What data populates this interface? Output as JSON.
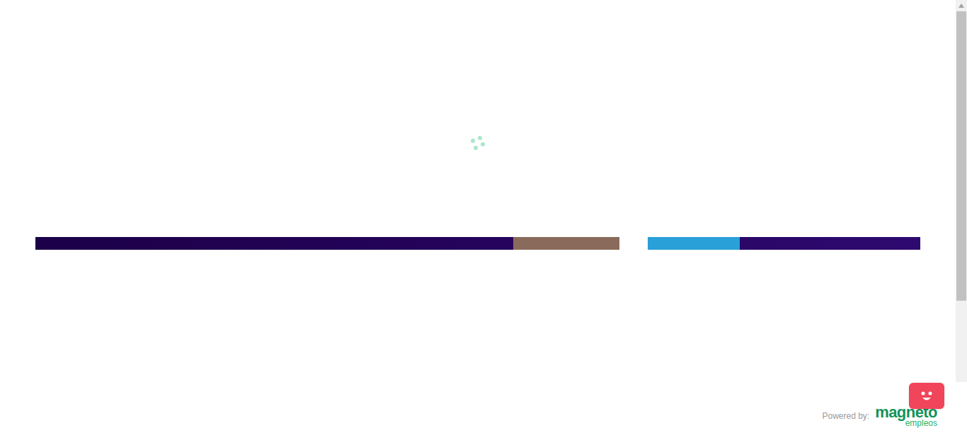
{
  "page": {
    "loading": true
  },
  "footer": {
    "label": "Powered by:",
    "logo": {
      "name": "magneto",
      "sub": "empleos"
    }
  },
  "scrollbar": {
    "level": 0.78
  }
}
